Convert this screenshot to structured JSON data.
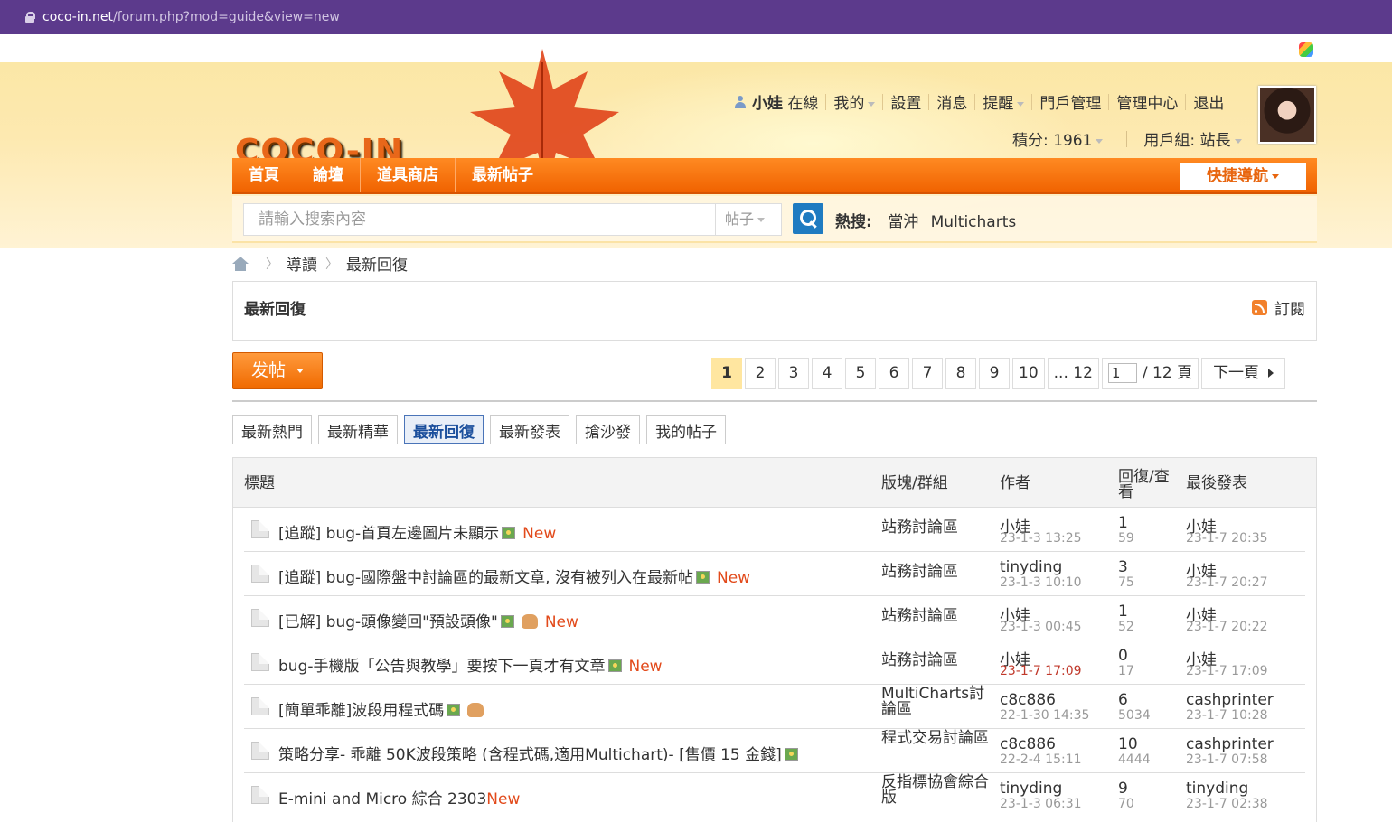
{
  "browser": {
    "host": "coco-in.net",
    "path": "/forum.php?mod=guide&view=new"
  },
  "header": {
    "logo": "COCO-IN",
    "user": "小娃",
    "status": "在線",
    "links": [
      "我的",
      "設置",
      "消息",
      "提醒",
      "門戶管理",
      "管理中心",
      "退出"
    ],
    "credits": "積分: 1961",
    "group": "用戶組: 站長"
  },
  "nav": {
    "items": [
      "首頁",
      "論壇",
      "道具商店",
      "最新帖子"
    ],
    "quick": "快捷導航"
  },
  "search": {
    "placeholder": "請輸入搜索內容",
    "type": "帖子",
    "hot_label": "熱搜:",
    "hot_terms": [
      "當沖",
      "Multicharts"
    ]
  },
  "breadcrumb": [
    "導讀",
    "最新回復"
  ],
  "panel": {
    "title": "最新回復",
    "rss": "訂閱"
  },
  "post_button": "发帖",
  "pager": {
    "pages": [
      "1",
      "2",
      "3",
      "4",
      "5",
      "6",
      "7",
      "8",
      "9",
      "10",
      "... 12"
    ],
    "input": "1",
    "total": "/ 12 頁",
    "next": "下一頁"
  },
  "tabs": [
    "最新熱門",
    "最新精華",
    "最新回復",
    "最新發表",
    "搶沙發",
    "我的帖子"
  ],
  "table": {
    "headers": [
      "標題",
      "版塊/群組",
      "作者",
      "回復/查看",
      "最後發表"
    ],
    "rows": [
      {
        "prefix": "[追蹤] ",
        "title": "bug-首頁左邊圖片未顯示",
        "img": true,
        "thumb": false,
        "new": "New",
        "forum": "站務討論區",
        "author": "小娃",
        "date": "23-1-3 13:25",
        "replies": "1",
        "views": "59",
        "last_user": "小娃",
        "last_date": "23-1-7 20:35"
      },
      {
        "prefix": "[追蹤] ",
        "title": "bug-國際盤中討論區的最新文章, 沒有被列入在最新帖",
        "img": true,
        "thumb": false,
        "new": "New",
        "forum": "站務討論區",
        "author": "tinyding",
        "date": "23-1-3 10:10",
        "replies": "3",
        "views": "75",
        "last_user": "小娃",
        "last_date": "23-1-7 20:27"
      },
      {
        "prefix": "[已解] ",
        "title": "bug-頭像變回\"預設頭像\"",
        "img": true,
        "thumb": true,
        "new": "New",
        "forum": "站務討論區",
        "author": "小娃",
        "date": "23-1-3 00:45",
        "replies": "1",
        "views": "52",
        "last_user": "小娃",
        "last_date": "23-1-7 20:22"
      },
      {
        "prefix": "",
        "title": "bug-手機版「公告與教學」要按下一頁才有文章",
        "img": true,
        "thumb": false,
        "new": "New",
        "forum": "站務討論區",
        "author": "小娃",
        "date": "23-1-7 17:09",
        "replies": "0",
        "views": "17",
        "last_user": "小娃",
        "last_date": "23-1-7 17:09"
      },
      {
        "prefix": "",
        "title": "[簡單乖離]波段用程式碼",
        "img": true,
        "thumb": true,
        "new": "",
        "forum": "MultiCharts討論區",
        "author": "c8c886",
        "date": "22-1-30 14:35",
        "replies": "6",
        "views": "5034",
        "last_user": "cashprinter",
        "last_date": "23-1-7 10:28"
      },
      {
        "prefix": "",
        "title": "策略分享- 乖離 50K波段策略 (含程式碼,適用Multichart)- [售價 15 金錢]",
        "img": true,
        "thumb": false,
        "new": "",
        "forum": "程式交易討論區",
        "author": "c8c886",
        "date": "22-2-4 15:11",
        "replies": "10",
        "views": "4444",
        "last_user": "cashprinter",
        "last_date": "23-1-7 07:58"
      },
      {
        "prefix": "",
        "title": "E-mini and Micro 綜合 2303",
        "img": false,
        "thumb": false,
        "new": "New",
        "forum": "反指標協會綜合版",
        "author": "tinyding",
        "date": "23-1-3 06:31",
        "replies": "9",
        "views": "70",
        "last_user": "tinyding",
        "last_date": "23-1-7 02:38"
      }
    ]
  },
  "colors": {
    "browser_bar": "#5c3a8c",
    "nav_orange": "#f06200",
    "new_red": "#e24a1b",
    "active_tab": "#1b4f9c"
  }
}
